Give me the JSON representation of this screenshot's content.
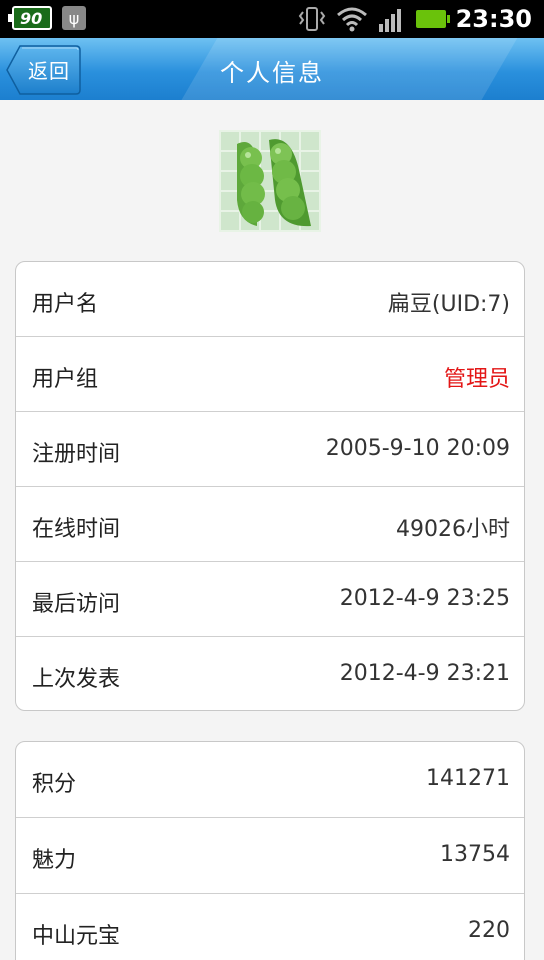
{
  "status_bar": {
    "battery_left_level": "90",
    "time": "23:30"
  },
  "header": {
    "back_label": "返回",
    "title": "个人信息"
  },
  "avatar": {
    "icon": "pea-pod-image"
  },
  "profile": {
    "rows": [
      {
        "label": "用户名",
        "value": "扁豆(UID:7)"
      },
      {
        "label": "用户组",
        "value": "管理员",
        "value_color": "#e31616"
      },
      {
        "label": "注册时间",
        "value": "2005-9-10 20:09"
      },
      {
        "label": "在线时间",
        "value": "49026小时"
      },
      {
        "label": "最后访问",
        "value": "2012-4-9 23:25"
      },
      {
        "label": "上次发表",
        "value": "2012-4-9 23:21"
      }
    ]
  },
  "stats": {
    "rows": [
      {
        "label": "积分",
        "value": "141271"
      },
      {
        "label": "魅力",
        "value": "13754"
      },
      {
        "label": "中山元宝",
        "value": "220"
      }
    ]
  }
}
